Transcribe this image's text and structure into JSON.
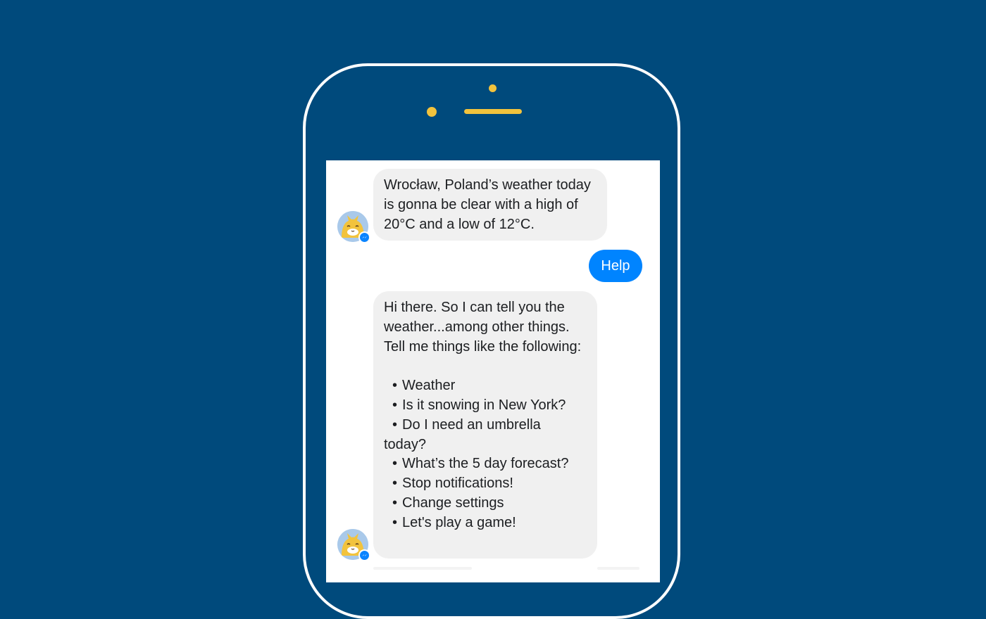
{
  "colors": {
    "background": "#004a7c",
    "phone_outline": "#ffffff",
    "phone_accent": "#f2c33d",
    "bot_bubble": "#f0f0f0",
    "user_bubble": "#0084ff",
    "messenger_badge": "#0a84ff"
  },
  "icons": {
    "bot_avatar": "cat-avatar-icon",
    "badge": "messenger-icon"
  },
  "messages": [
    {
      "sender": "bot",
      "text": "Wrocław, Poland’s weather today is gonna be clear with a high of 20°C and a low of 12°C."
    },
    {
      "sender": "user",
      "text": "Help"
    },
    {
      "sender": "bot",
      "intro": "Hi there. So I can tell you the weather...among other things. Tell me things like the following:",
      "list": [
        "Weather",
        "Is it snowing in New York?",
        "Do I need an umbrella today?",
        "What’s the 5 day forecast?",
        "Stop notifications!",
        "Change settings",
        "Let's play a game!"
      ]
    }
  ]
}
